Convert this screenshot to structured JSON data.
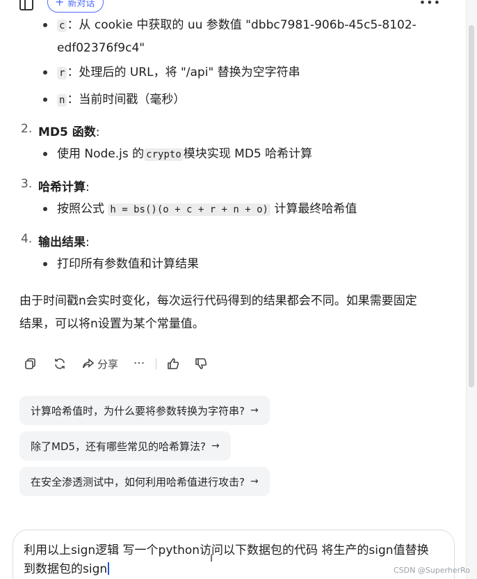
{
  "topbar": {
    "new_chat_label": "新对话"
  },
  "details": {
    "c": {
      "key": "c",
      "text": "：从 cookie 中获取的 uu 参数值 \"dbbc7981-906b-45c5-8102-",
      "text2": "edf02376f9c4\""
    },
    "r": {
      "key": "r",
      "text": "：处理后的 URL，将 \"/api\" 替换为空字符串"
    },
    "n": {
      "key": "n",
      "text": "：当前时间戳（毫秒）"
    }
  },
  "steps": [
    {
      "num": "2.",
      "title": "MD5 函数",
      "colon": ":",
      "sub_pre": "使用 Node.js 的",
      "sub_code": "crypto",
      "sub_post": "模块实现 MD5 哈希计算"
    },
    {
      "num": "3.",
      "title": "哈希计算",
      "colon": ":",
      "sub_pre": "按照公式 ",
      "sub_code": "h = bs()(o + c + r + n + o)",
      "sub_post": " 计算最终哈希值"
    },
    {
      "num": "4.",
      "title": "输出结果",
      "colon": ":",
      "sub_pre": "打印所有参数值和计算结果"
    }
  ],
  "summary": {
    "line1": "由于时间戳n会实时变化，每次运行代码得到的结果都会不同。如果需要固定",
    "line2": "结果，可以将n设置为某个常量值。"
  },
  "actions": {
    "share_label": "分享",
    "more": "···"
  },
  "suggestions": [
    "计算哈希值时，为什么要将参数转换为字符串?",
    "除了MD5，还有哪些常见的哈希算法?",
    "在安全渗透测试中，如何利用哈希值进行攻击?"
  ],
  "suggestion_arrow": "→",
  "input": {
    "line1": "利用以上sign逻辑 写一个python访问以下数据包的代码 将生产的sign值替换",
    "line2": "到数据包的sign"
  },
  "watermark": "CSDN @SuperherRo"
}
